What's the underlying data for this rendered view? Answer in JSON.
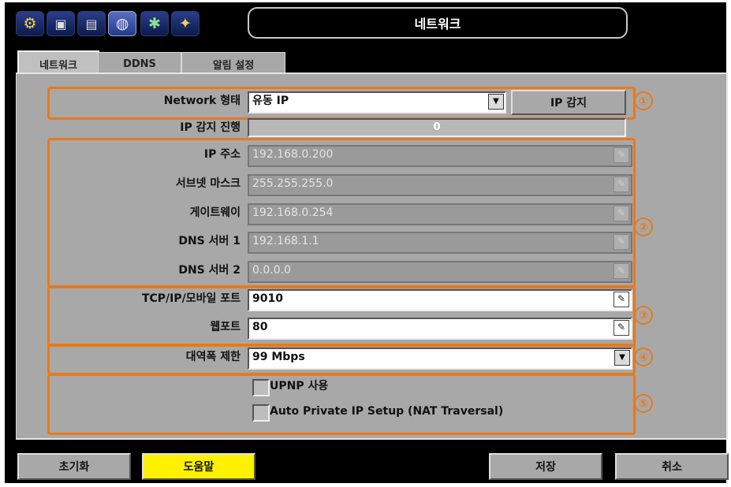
{
  "window": {
    "title": "네트워크"
  },
  "top_icons": [
    {
      "name": "gear-icon",
      "glyph": "⚙"
    },
    {
      "name": "camera-icon",
      "glyph": "📷"
    },
    {
      "name": "storage-icon",
      "glyph": "💾"
    },
    {
      "name": "network-globe-icon",
      "glyph": "🌐"
    },
    {
      "name": "event-icon",
      "glyph": "🔔"
    },
    {
      "name": "tools-icon",
      "glyph": "🔧"
    }
  ],
  "tabs": [
    "네트워크",
    "DDNS",
    "알림 설정"
  ],
  "form": {
    "network_type_label": "Network 형태",
    "network_type_value": "유동 IP",
    "ip_detect_button": "IP 감지",
    "ip_progress_label": "IP 감지 진행",
    "ip_progress_value": "0",
    "ip_label": "IP 주소",
    "ip_value": "192.168.0.200",
    "subnet_label": "서브넷 마스크",
    "subnet_value": "255.255.255.0",
    "gateway_label": "게이트웨이",
    "gateway_value": "192.168.0.254",
    "dns1_label": "DNS 서버 1",
    "dns1_value": "192.168.1.1",
    "dns2_label": "DNS 서버 2",
    "dns2_value": "0.0.0.0",
    "tcp_port_label": "TCP/IP/모바일 포트",
    "tcp_port_value": "9010",
    "web_port_label": "웹포트",
    "web_port_value": "80",
    "bandwidth_label": "대역폭 제한",
    "bandwidth_value": "99 Mbps",
    "upnp_label": "UPNP 사용",
    "upnp_checked": false,
    "auto_private_ip_label": "Auto Private IP Setup (NAT Traversal)",
    "auto_private_ip_checked": false
  },
  "group_markers": [
    "①",
    "②",
    "③",
    "④",
    "⑤"
  ],
  "buttons": {
    "reset": "초기화",
    "help": "도움말",
    "save": "저장",
    "cancel": "취소"
  },
  "colors": {
    "accent_orange": "#e8791c",
    "panel_gray": "#a8a8a8",
    "help_yellow": "#fff200"
  }
}
